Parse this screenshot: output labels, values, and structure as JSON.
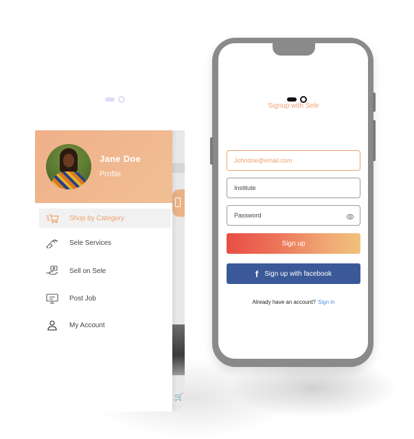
{
  "drawer": {
    "user": {
      "name": "Jane Doe",
      "subtitle": "Profile"
    },
    "items": [
      {
        "label": "Shop by Category",
        "icon": "cart-fast-icon",
        "active": true
      },
      {
        "label": "Sele Services",
        "icon": "services-icon",
        "active": false
      },
      {
        "label": "Sell on Sele",
        "icon": "hand-money-icon",
        "active": false
      },
      {
        "label": "Post Job",
        "icon": "monitor-icon",
        "active": false
      },
      {
        "label": "My Account",
        "icon": "user-icon",
        "active": false
      }
    ]
  },
  "signup": {
    "title": "Signup with Sele",
    "email_placeholder": "Johndoe@email.com",
    "institute_placeholder": "Institute",
    "password_placeholder": "Password",
    "signup_label": "Sign up",
    "facebook_label": "Sign up with facebook",
    "facebook_glyph": "f",
    "signin_prompt": "Already have an account?",
    "signin_link": "Sign in"
  },
  "colors": {
    "accent": "#f0a06d",
    "facebook": "#3b5998",
    "link": "#4a90d9",
    "gradient_start": "#e84e45",
    "gradient_end": "#f0c27a"
  }
}
